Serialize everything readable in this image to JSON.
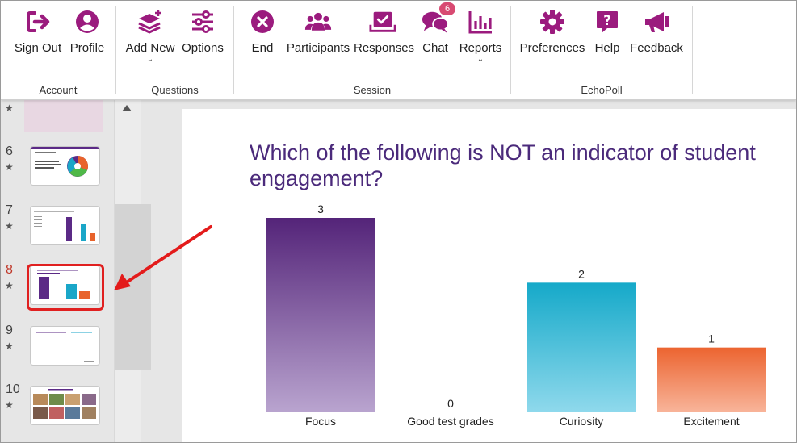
{
  "ribbon": {
    "groups": [
      {
        "label": "Account",
        "buttons": [
          {
            "label": "Sign Out",
            "icon": "sign-out-icon"
          },
          {
            "label": "Profile",
            "icon": "profile-icon"
          }
        ]
      },
      {
        "label": "Questions",
        "buttons": [
          {
            "label": "Add New",
            "icon": "add-new-icon",
            "dropdown": true
          },
          {
            "label": "Options",
            "icon": "options-icon"
          }
        ]
      },
      {
        "label": "Session",
        "buttons": [
          {
            "label": "End",
            "icon": "end-icon"
          },
          {
            "label": "Participants",
            "icon": "participants-icon"
          },
          {
            "label": "Responses",
            "icon": "responses-icon"
          },
          {
            "label": "Chat",
            "icon": "chat-icon",
            "badge": "6"
          },
          {
            "label": "Reports",
            "icon": "reports-icon",
            "dropdown": true
          }
        ]
      },
      {
        "label": "EchoPoll",
        "buttons": [
          {
            "label": "Preferences",
            "icon": "preferences-icon"
          },
          {
            "label": "Help",
            "icon": "help-icon"
          },
          {
            "label": "Feedback",
            "icon": "feedback-icon"
          }
        ]
      }
    ],
    "accent": "#9b1b7e"
  },
  "thumbnails": [
    {
      "number": "6",
      "star": "★",
      "kind": "pie"
    },
    {
      "number": "7",
      "star": "★",
      "kind": "bars"
    },
    {
      "number": "8",
      "star": "★",
      "kind": "bars",
      "selected": true
    },
    {
      "number": "9",
      "star": "★",
      "kind": "text"
    },
    {
      "number": "10",
      "star": "★",
      "kind": "photos"
    }
  ],
  "top_partial_star": "★",
  "slide": {
    "title": "Which of the following is NOT an indicator of student engagement?"
  },
  "chart_data": {
    "type": "bar",
    "categories": [
      "Focus",
      "Good test grades",
      "Curiosity",
      "Excitement"
    ],
    "values": [
      3,
      0,
      2,
      1
    ],
    "colors": [
      [
        "#542479",
        "#b9a4cf"
      ],
      [
        "#ffffff",
        "#ffffff"
      ],
      [
        "#15a9c9",
        "#8fd9ec"
      ],
      [
        "#ec6430",
        "#f8b49a"
      ]
    ],
    "ylim": [
      0,
      3
    ]
  },
  "annotation": {
    "arrow_color": "#e31b1b"
  }
}
